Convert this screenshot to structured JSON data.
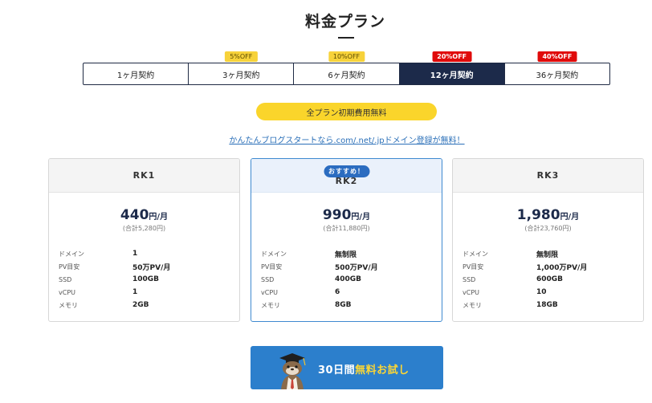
{
  "page": {
    "title": "料金プラン"
  },
  "tabs": [
    {
      "label": "1ヶ月契約",
      "badge": "",
      "badge_color": ""
    },
    {
      "label": "3ヶ月契約",
      "badge": "5%OFF",
      "badge_color": "yellow"
    },
    {
      "label": "6ヶ月契約",
      "badge": "10%OFF",
      "badge_color": "yellow"
    },
    {
      "label": "12ヶ月契約",
      "badge": "20%OFF",
      "badge_color": "red",
      "active": true
    },
    {
      "label": "36ヶ月契約",
      "badge": "40%OFF",
      "badge_color": "red"
    }
  ],
  "promo": {
    "free_pill": "全プラン初期費用無料",
    "domain_link": "かんたんブログスタートなら.com/.net/.jpドメイン登録が無料！"
  },
  "plans": [
    {
      "name": "RK1",
      "recommend": "",
      "price": "440",
      "unit": "円/月",
      "total": "(合計5,280円)",
      "specs": [
        {
          "key": "ドメイン",
          "value": "1"
        },
        {
          "key": "PV目安",
          "value": "50万PV/月"
        },
        {
          "key": "SSD",
          "value": "100GB"
        },
        {
          "key": "vCPU",
          "value": "1"
        },
        {
          "key": "メモリ",
          "value": "2GB"
        }
      ]
    },
    {
      "name": "RK2",
      "recommend": "おすすめ！",
      "price": "990",
      "unit": "円/月",
      "total": "(合計11,880円)",
      "specs": [
        {
          "key": "ドメイン",
          "value": "無制限"
        },
        {
          "key": "PV目安",
          "value": "500万PV/月"
        },
        {
          "key": "SSD",
          "value": "400GB"
        },
        {
          "key": "vCPU",
          "value": "6"
        },
        {
          "key": "メモリ",
          "value": "8GB"
        }
      ]
    },
    {
      "name": "RK3",
      "recommend": "",
      "price": "1,980",
      "unit": "円/月",
      "total": "(合計23,760円)",
      "specs": [
        {
          "key": "ドメイン",
          "value": "無制限"
        },
        {
          "key": "PV目安",
          "value": "1,000万PV/月"
        },
        {
          "key": "SSD",
          "value": "600GB"
        },
        {
          "key": "vCPU",
          "value": "10"
        },
        {
          "key": "メモリ",
          "value": "18GB"
        }
      ]
    }
  ],
  "cta": {
    "label_prefix": "30日間",
    "label_highlight": "無料お試し",
    "mascot_icon": "otter-mascot-icon"
  },
  "colors": {
    "navy": "#1c2a4a",
    "yellow": "#fad52b",
    "red": "#e00b0b",
    "blue": "#2c7fcc"
  }
}
